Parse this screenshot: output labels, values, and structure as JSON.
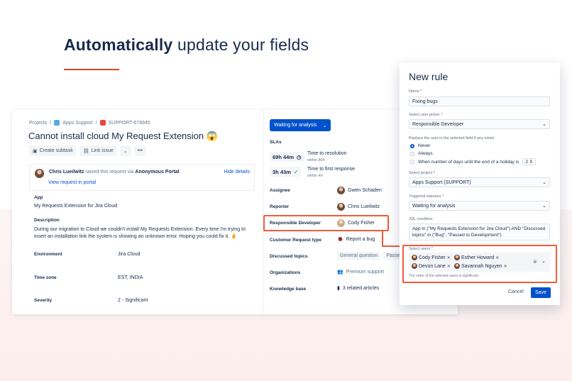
{
  "headline": {
    "bold": "Automatically",
    "rest": "update your fields"
  },
  "colors": {
    "accent": "#d7442b",
    "primary": "#0052cc",
    "highlight": "#ef5b3a"
  },
  "issue": {
    "breadcrumbs": [
      "Projects",
      "/",
      "Apps Support",
      "/",
      "SUPPORT-678945"
    ],
    "title": "Cannot install cloud My Request Extension 😱",
    "toolbar": {
      "create_subtask": "Create subtask",
      "link_issue": "Link issue"
    },
    "reporter_line": {
      "name": "Chris Lueilwitz",
      "middle": "raised this request via",
      "portal": "Anonymous Portal"
    },
    "view_request": "View request in portal",
    "hide_details": "Hide details",
    "app_label": "App",
    "app_value": "My Requests Extension for Jira Cloud",
    "description_label": "Description",
    "description": "During our migration to Cloud we couldn't install My Requests Extension. Every time i'm trying to insert an installation link the system is showing an unknown error. Hoping you could fix it. 🤞",
    "fields": [
      {
        "label": "Environment",
        "value": "Jira Cloud"
      },
      {
        "label": "Time zone",
        "value": "EST, INDIA"
      },
      {
        "label": "Severity",
        "value": "2 - Significant"
      }
    ],
    "status": "Waiting for analysis",
    "slas_label": "SLAs",
    "slas": [
      {
        "time": "69h 44m",
        "name": "Time to resolution",
        "sub": "within 80h"
      },
      {
        "time": "3h 43m",
        "name": "Time to first response",
        "sub": "within 4h"
      }
    ],
    "details": {
      "assignee": {
        "label": "Assignee",
        "value": "Gwen Schaden"
      },
      "reporter": {
        "label": "Reporter",
        "value": "Chris Lueilwitz"
      },
      "responsible": {
        "label": "Responsible Developer",
        "value": "Cody Fisher"
      },
      "request_type": {
        "label": "Customer Request type",
        "value": "Report a bug"
      },
      "topics": {
        "label": "Discussed topics",
        "values": [
          "General question",
          "Passed to"
        ]
      },
      "organizations": {
        "label": "Organizations",
        "value": "Premium support"
      },
      "kb": {
        "label": "Knowledge base",
        "value": "3 related articles"
      }
    }
  },
  "rule": {
    "title": "New rule",
    "name_label": "Name *",
    "name_value": "Fixing bugs",
    "picker_label": "Select user picker *",
    "picker_value": "Responsible Developer",
    "replace_label": "Replace the user in the selected field if any exists",
    "radios": [
      "Never",
      "Always",
      "When number of days until the end of a holiday is"
    ],
    "radio_selected": "Never",
    "days_value": "2",
    "project_label": "Select project *",
    "project_value": "Apps Support (SUPPORT)",
    "statuses_label": "Triggered statuses *",
    "statuses_value": "Waiting for analysis",
    "jql_label": "JQL condition",
    "jql_value": "App in (\"My Requests Extension for Jira Cloud\") AND \"Discussed topics\" in (\"Bug\", \"Passed to Development\")",
    "users_label": "Select users *",
    "users": [
      "Cody Fisher",
      "Esther Howard",
      "Devon Lane",
      "Savannah Nguyen"
    ],
    "users_helper": "The order of the selected users is significant.",
    "cancel": "Cancel",
    "save": "Save"
  }
}
